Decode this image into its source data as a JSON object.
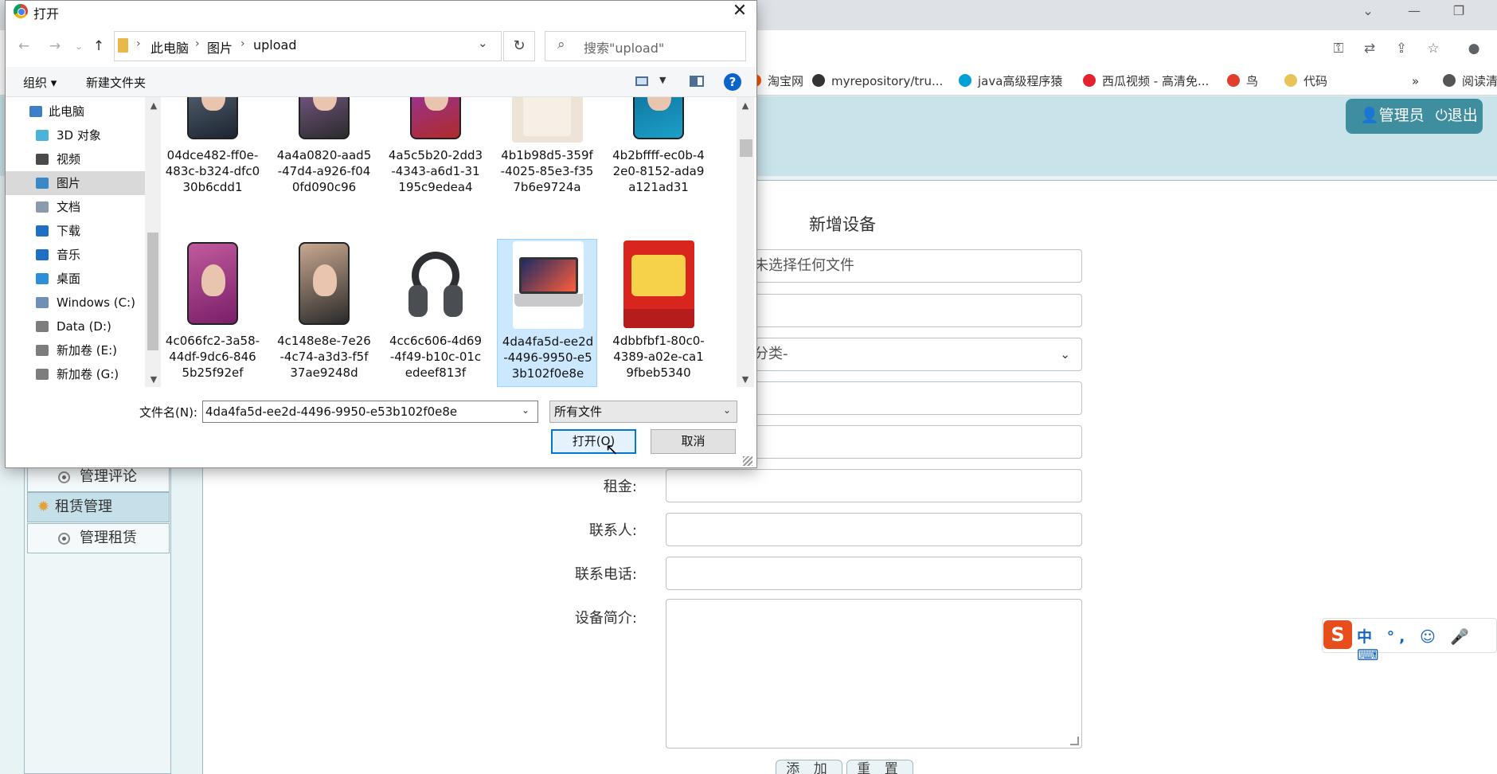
{
  "browser": {
    "bookmarks": [
      {
        "label": "淘宝网",
        "color": "#ff5000"
      },
      {
        "label": "myrepository/tru...",
        "color": "#333333"
      },
      {
        "label": "java高级程序猿",
        "color": "#00a1d6"
      },
      {
        "label": "西瓜视频 - 高清免...",
        "color": "#e5212d"
      },
      {
        "label": "鸟",
        "color": "#e23e2e"
      },
      {
        "label": "代码",
        "color": "#e8c35a"
      },
      {
        "label": "阅读清",
        "color": "#555555"
      }
    ],
    "more_label": "»"
  },
  "page": {
    "user_label": "管理员",
    "logout_label": "退出",
    "menu": [
      {
        "type": "item",
        "label": "管理评论"
      },
      {
        "type": "category",
        "label": "租赁管理"
      },
      {
        "type": "item",
        "label": "管理租赁"
      }
    ],
    "form": {
      "title": "新增设备",
      "file_field_text": "未选择任何文件",
      "category_select_text": "分类-",
      "labels": {
        "rent": "租金:",
        "contact": "联系人:",
        "phone": "联系电话:",
        "intro": "设备简介:"
      },
      "add_button": "添 加",
      "reset_button": "重 置"
    },
    "ime": {
      "brand": "S",
      "text": "中 °, ☺ 🎤 ⌨"
    }
  },
  "dialog": {
    "title": "打开",
    "breadcrumb": [
      "此电脑",
      "图片",
      "upload"
    ],
    "search_placeholder": "搜索\"upload\"",
    "toolbar": {
      "organize": "组织 ▾",
      "new_folder": "新建文件夹",
      "help": "?"
    },
    "tree": [
      {
        "label": "此电脑",
        "color": "#3c7fc7",
        "selected": false,
        "indent": 1
      },
      {
        "label": "3D 对象",
        "color": "#4cb3d8",
        "selected": false,
        "indent": 2
      },
      {
        "label": "视频",
        "color": "#4a4a4a",
        "selected": false,
        "indent": 2
      },
      {
        "label": "图片",
        "color": "#3b88c8",
        "selected": true,
        "indent": 2
      },
      {
        "label": "文档",
        "color": "#8a9bb0",
        "selected": false,
        "indent": 2
      },
      {
        "label": "下载",
        "color": "#1f6fc5",
        "selected": false,
        "indent": 2
      },
      {
        "label": "音乐",
        "color": "#1f6fc5",
        "selected": false,
        "indent": 2
      },
      {
        "label": "桌面",
        "color": "#2f8ed8",
        "selected": false,
        "indent": 2
      },
      {
        "label": "Windows (C:)",
        "color": "#6f8fb5",
        "selected": false,
        "indent": 2
      },
      {
        "label": "Data (D:)",
        "color": "#7d7d7d",
        "selected": false,
        "indent": 2
      },
      {
        "label": "新加卷 (E:)",
        "color": "#7d7d7d",
        "selected": false,
        "indent": 2
      },
      {
        "label": "新加卷 (G:)",
        "color": "#7d7d7d",
        "selected": false,
        "indent": 2
      }
    ],
    "files": [
      {
        "name": "04dce482-ff0e-483c-b324-dfc030b6cdd1",
        "lines": [
          "04dce482-ff0e-",
          "483c-b324-dfc0",
          "30b6cdd1"
        ],
        "kind": "phone",
        "c1": "#1c2430",
        "c2": "#6b7b8c",
        "selected": false
      },
      {
        "name": "4a4a0820-aad5-47d4-a926-f040fd090c96",
        "lines": [
          "4a4a0820-aad5",
          "-47d4-a926-f04",
          "0fd090c96"
        ],
        "kind": "phone",
        "c1": "#2b2b2b",
        "c2": "#9b6bb0",
        "selected": false
      },
      {
        "name": "4a5c5b20-2dd3-4343-a6d1-31195c9edea4",
        "lines": [
          "4a5c5b20-2dd3",
          "-4343-a6d1-31",
          "195c9edea4"
        ],
        "kind": "phone",
        "c1": "#b02a2a",
        "c2": "#8a3ac8",
        "selected": false
      },
      {
        "name": "4b1b98d5-359f-4025-85e3-f357b6e9724a",
        "lines": [
          "4b1b98d5-359f",
          "-4025-85e3-f35",
          "7b6e9724a"
        ],
        "kind": "cloth",
        "c1": "#f6efe6",
        "c2": "#ede3d6",
        "selected": false
      },
      {
        "name": "4b2bffff-ec0b-42e0-8152-ada9a121ad31",
        "lines": [
          "4b2bffff-ec0b-4",
          "2e0-8152-ada9",
          "a121ad31"
        ],
        "kind": "phone",
        "c1": "#1aa0c8",
        "c2": "#0d5f8a",
        "selected": false
      },
      {
        "name": "4c066fc2-3a58-44df-9dc6-8465b25f92ef",
        "lines": [
          "4c066fc2-3a58-",
          "44df-9dc6-846",
          "5b25f92ef"
        ],
        "kind": "phone",
        "c1": "#7a1f6a",
        "c2": "#c05a9c",
        "selected": false
      },
      {
        "name": "4c148e8e-7e26-4c74-a3d3-f5f37ae9248d",
        "lines": [
          "4c148e8e-7e26",
          "-4c74-a3d3-f5f",
          "37ae9248d"
        ],
        "kind": "phone",
        "c1": "#2a2a2a",
        "c2": "#c8a890",
        "selected": false
      },
      {
        "name": "4cc6c606-4d69-4f49-b10c-01cedeef813f",
        "lines": [
          "4cc6c606-4d69",
          "-4f49-b10c-01c",
          "edeef813f"
        ],
        "kind": "headphone",
        "c1": "#2d2f33",
        "c2": "#4a4d52",
        "selected": false
      },
      {
        "name": "4da4fa5d-ee2d-4496-9950-e53b102f0e8e",
        "lines": [
          "4da4fa5d-ee2d",
          "-4496-9950-e5",
          "3b102f0e8e"
        ],
        "kind": "laptop",
        "c1": "#ff5e3a",
        "c2": "#c9c9cc",
        "selected": true
      },
      {
        "name": "4dbbfbf1-80c0-4389-a02e-ca19fbeb5340",
        "lines": [
          "4dbbfbf1-80c0-",
          "4389-a02e-ca1",
          "9fbeb5340"
        ],
        "kind": "promo",
        "c1": "#d8261f",
        "c2": "#f6d24a",
        "selected": false
      }
    ],
    "filename_label": "文件名(N):",
    "filename_value": "4da4fa5d-ee2d-4496-9950-e53b102f0e8e",
    "filetype_value": "所有文件",
    "open_button": "打开(O)",
    "cancel_button": "取消"
  }
}
